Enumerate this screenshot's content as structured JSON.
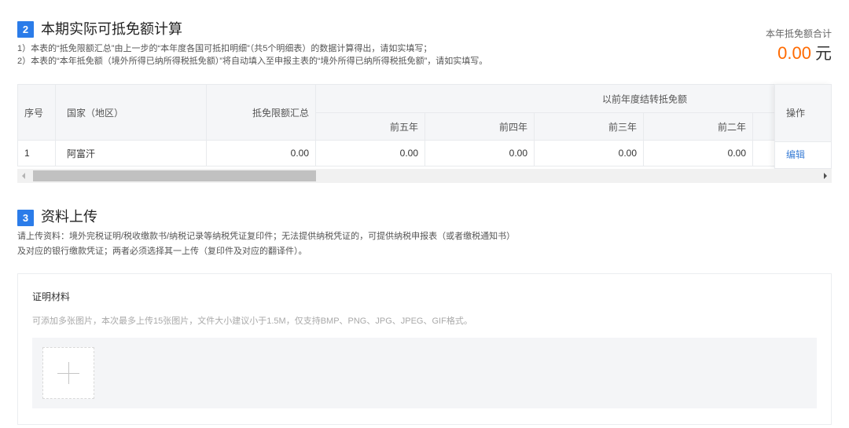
{
  "colors": {
    "badge": "#2b7ce9",
    "accent_orange": "#ff6a00",
    "link": "#3c7fd6",
    "header_bg": "#f5f6f8",
    "border": "#e8eaed",
    "drop_bg": "#f4f5f7",
    "hint": "#a9a9a9"
  },
  "icons": {
    "scroll_left": "scroll-left-arrow-icon",
    "scroll_right": "scroll-right-arrow-icon",
    "add_image": "plus-icon"
  },
  "section2": {
    "badge": "2",
    "title": "本期实际可抵免额计算",
    "notes": [
      "1）本表的“抵免限额汇总”由上一步的“本年度各国可抵扣明细”（共5个明细表）的数据计算得出，请如实填写；",
      "2）本表的“本年抵免额（境外所得已纳所得税抵免额）”将自动填入至申报主表的“境外所得已纳所得税抵免额”，请如实填写。"
    ]
  },
  "total": {
    "label": "本年抵免额合计",
    "value": "0.00",
    "unit": "元"
  },
  "table": {
    "headers": {
      "index": "序号",
      "country": "国家（地区）",
      "limit": "抵免限额汇总",
      "carry_group": "以前年度结转抵免额",
      "carry_years": [
        "前五年",
        "前四年",
        "前三年",
        "前二年"
      ],
      "action": "操作"
    },
    "rows": [
      {
        "index": "1",
        "country": "阿富汗",
        "limit": "0.00",
        "carry": [
          "0.00",
          "0.00",
          "0.00",
          "0.00"
        ],
        "action": "编辑"
      }
    ]
  },
  "section3": {
    "badge": "3",
    "title": "资料上传",
    "notes": [
      "请上传资料：境外完税证明/税收缴款书/纳税记录等纳税凭证复印件；无法提供纳税凭证的，可提供纳税申报表（或者缴税通知书）",
      "及对应的银行缴款凭证；两者必须选择其一上传（复印件及对应的翻译件）。"
    ]
  },
  "upload": {
    "title": "证明材料",
    "hint": "可添加多张图片，本次最多上传15张图片，文件大小建议小于1.5M，仅支持BMP、PNG、JPG、JPEG、GIF格式。"
  }
}
